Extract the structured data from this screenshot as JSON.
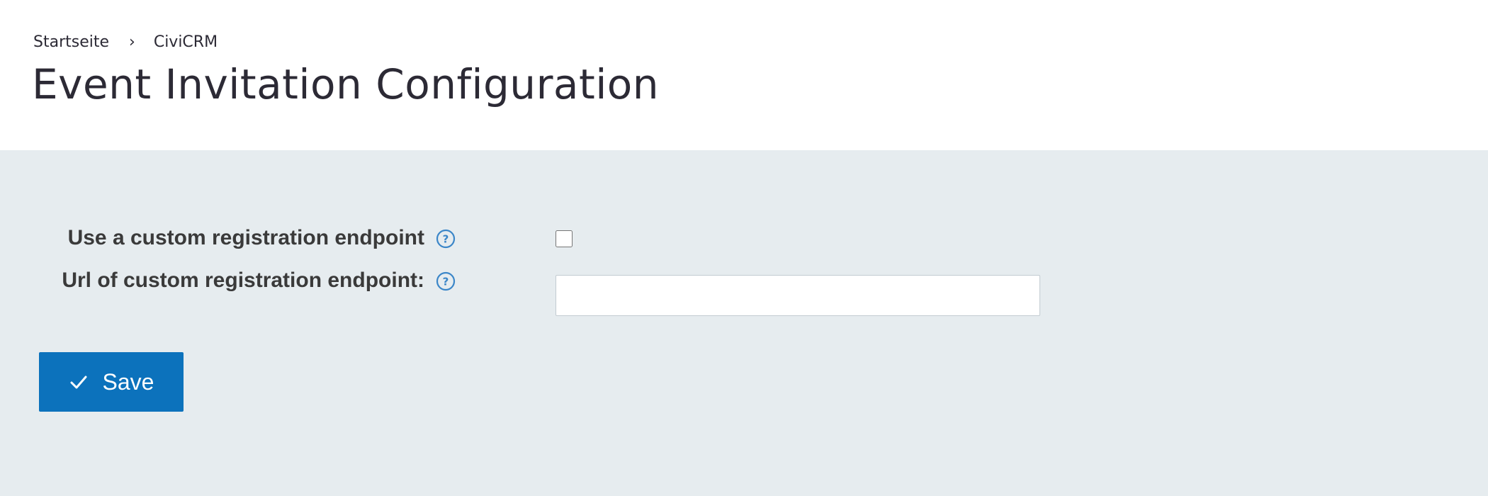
{
  "breadcrumb": {
    "items": [
      "Startseite",
      "CiviCRM"
    ],
    "separator": "›"
  },
  "page": {
    "title": "Event Invitation Configuration"
  },
  "form": {
    "custom_endpoint": {
      "label": "Use a custom registration endpoint",
      "checked": false,
      "help_icon": "help-circle-icon"
    },
    "endpoint_url": {
      "label": "Url of custom registration endpoint:",
      "value": "",
      "placeholder": "",
      "help_icon": "help-circle-icon"
    }
  },
  "actions": {
    "save_label": "Save",
    "save_icon": "check-icon"
  },
  "colors": {
    "header_bg": "#ffffff",
    "content_bg": "#e6ecef",
    "primary_button": "#0c72bc",
    "help_icon": "#3b86c8",
    "title_text": "#2c2a35"
  }
}
